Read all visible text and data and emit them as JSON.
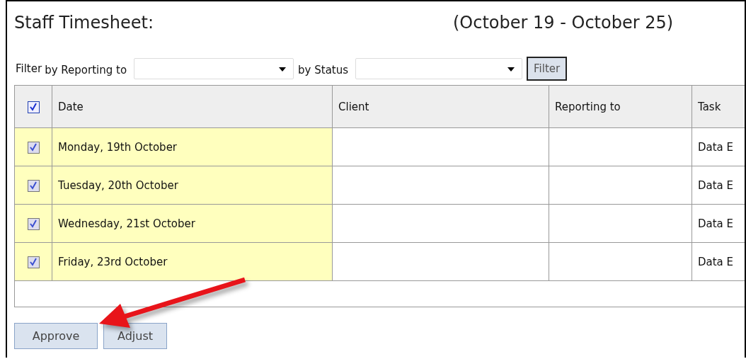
{
  "title": "Staff Timesheet:",
  "period": "(October 19 - October 25)",
  "filter": {
    "label": "Filter",
    "reporting_label": "by Reporting to",
    "status_label": "by Status",
    "button": "Filter"
  },
  "table": {
    "select_all_checked": true,
    "columns": [
      "Date",
      "Client",
      "Reporting to",
      "Task"
    ],
    "rows": [
      {
        "checked": true,
        "date": "Monday, 19th October",
        "client": "",
        "reporting_to": "",
        "task": "Data E"
      },
      {
        "checked": true,
        "date": "Tuesday, 20th October",
        "client": "",
        "reporting_to": "",
        "task": "Data E"
      },
      {
        "checked": true,
        "date": "Wednesday, 21st October",
        "client": "",
        "reporting_to": "",
        "task": "Data E"
      },
      {
        "checked": true,
        "date": "Friday, 23rd October",
        "client": "",
        "reporting_to": "",
        "task": "Data E"
      }
    ]
  },
  "buttons": [
    "Approve",
    "Adjust"
  ]
}
